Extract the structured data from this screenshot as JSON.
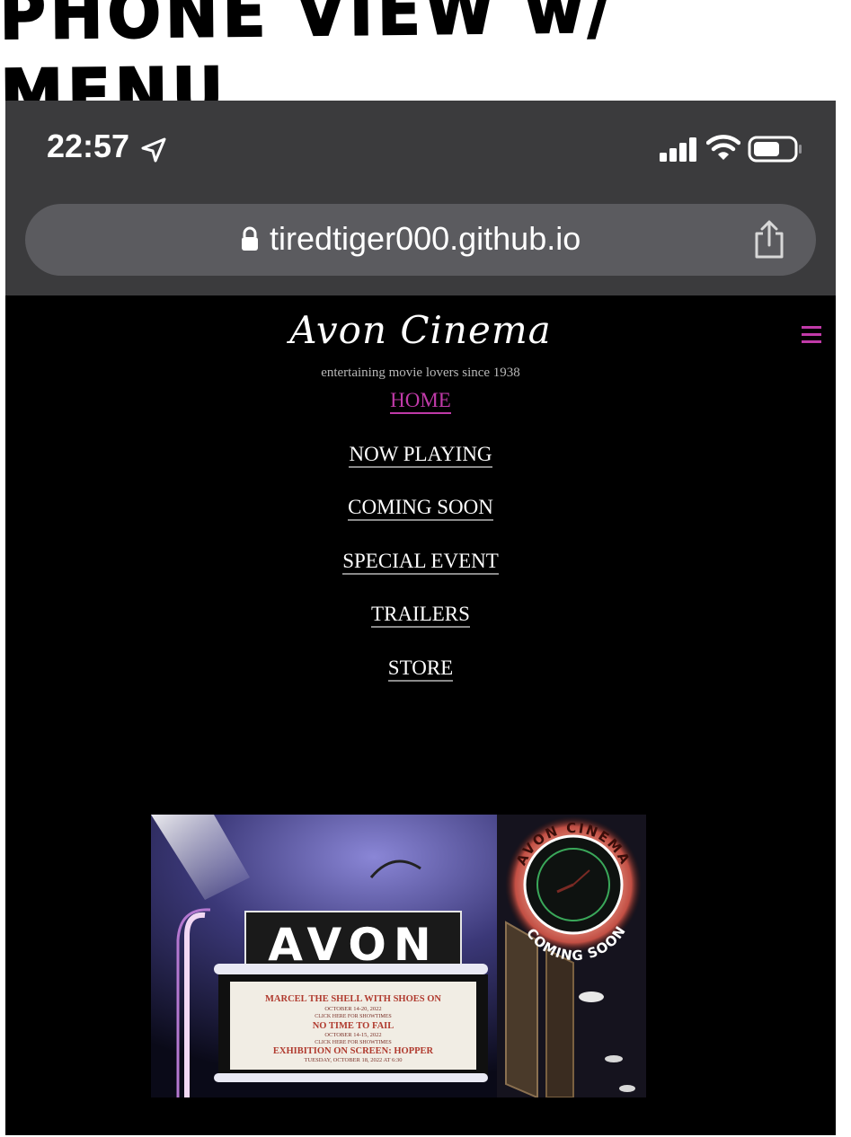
{
  "caption": "PHONE VIEW w/ MENU",
  "status_bar": {
    "time": "22:57",
    "location_icon": "location-arrow-icon",
    "signal_icon": "cellular-signal-icon",
    "wifi_icon": "wifi-icon",
    "battery_icon": "battery-icon"
  },
  "browser": {
    "url": "tiredtiger000.github.io",
    "lock_icon": "lock-icon",
    "share_icon": "share-icon"
  },
  "site": {
    "title": "Avon Cinema",
    "tagline": "entertaining movie lovers since 1938",
    "menu_icon": "hamburger-menu-icon",
    "accent_color": "#c03aa8",
    "nav": [
      {
        "label": "HOME",
        "active": true
      },
      {
        "label": "NOW PLAYING",
        "active": false
      },
      {
        "label": "COMING SOON",
        "active": false
      },
      {
        "label": "SPECIAL EVENT",
        "active": false
      },
      {
        "label": "TRAILERS",
        "active": false
      },
      {
        "label": "STORE",
        "active": false
      }
    ]
  },
  "hero": {
    "marquee_title": "AVON",
    "clock_sign_top": "AVON CINEMA",
    "clock_sign_bottom": "COMING SOON",
    "marquee_lines": [
      "MARCEL THE SHELL WITH SHOES ON",
      "OCTOBER 14-20, 2022",
      "CLICK HERE FOR SHOWTIMES",
      "NO TIME TO FAIL",
      "OCTOBER 14-15, 2022",
      "CLICK HERE FOR SHOWTIMES",
      "EXHIBITION ON SCREEN: HOPPER",
      "TUESDAY, OCTOBER 18, 2022 AT 6:30"
    ]
  }
}
